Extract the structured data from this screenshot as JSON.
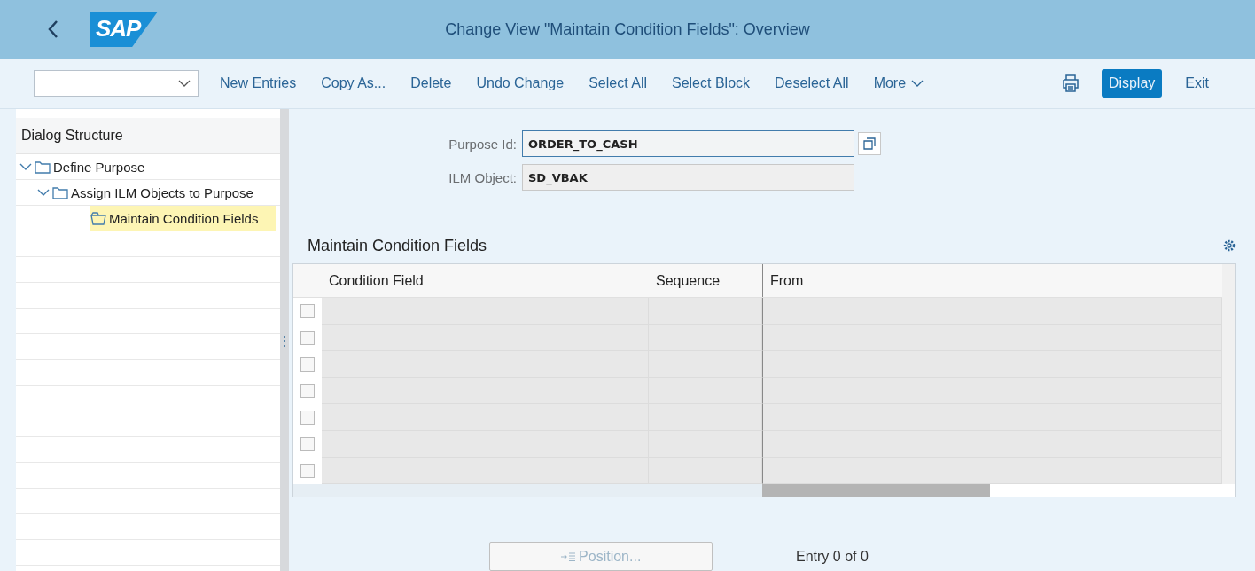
{
  "header": {
    "logo": "SAP",
    "title": "Change View \"Maintain Condition Fields\": Overview"
  },
  "toolbar": {
    "actions": [
      "New Entries",
      "Copy As...",
      "Delete",
      "Undo Change",
      "Select All",
      "Select Block",
      "Deselect All"
    ],
    "more": "More",
    "display": {
      "label": "Display",
      "selected": true
    },
    "exit": "Exit"
  },
  "sidebar": {
    "title": "Dialog Structure",
    "tree": [
      {
        "label": "Define Purpose",
        "expanded": true,
        "selected": false,
        "children": [
          {
            "label": "Assign ILM Objects to Purpose",
            "expanded": true,
            "selected": false,
            "children": [
              {
                "label": "Maintain Condition Fields",
                "selected": true
              }
            ]
          }
        ]
      }
    ]
  },
  "form": {
    "fields": [
      {
        "label": "Purpose Id:",
        "value": "ORDER_TO_CASH",
        "focused": true
      },
      {
        "label": "ILM Object:",
        "value": "SD_VBAK",
        "focused": false
      }
    ]
  },
  "table": {
    "title": "Maintain Condition Fields",
    "columns": [
      "Condition Field",
      "Sequence",
      "From"
    ],
    "rows": [
      {
        "selected": false
      },
      {
        "selected": false
      },
      {
        "selected": false
      },
      {
        "selected": false
      },
      {
        "selected": false
      },
      {
        "selected": false
      },
      {
        "selected": false
      }
    ]
  },
  "footer": {
    "position_button": "Position...",
    "entry_count": "Entry 0 of 0"
  }
}
